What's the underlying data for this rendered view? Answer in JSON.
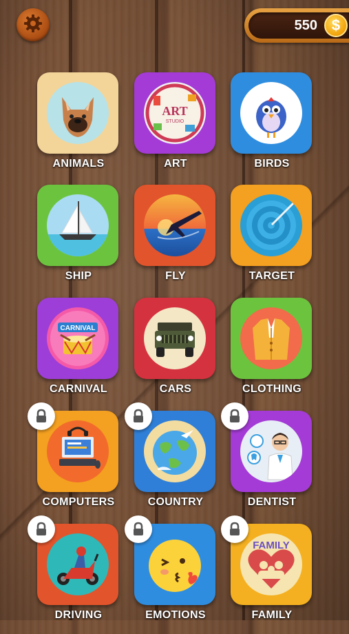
{
  "header": {
    "settings_icon": "gear-icon",
    "coins": "550",
    "coin_symbol": "$"
  },
  "categories": [
    {
      "label": "ANIMALS",
      "locked": false,
      "icon": "dog-icon",
      "color": "#f3d59a"
    },
    {
      "label": "ART",
      "locked": false,
      "icon": "art-studio-icon",
      "color": "#a43bd6"
    },
    {
      "label": "BIRDS",
      "locked": false,
      "icon": "bird-icon",
      "color": "#2f8de0"
    },
    {
      "label": "SHIP",
      "locked": false,
      "icon": "sailboat-icon",
      "color": "#6cc43e"
    },
    {
      "label": "FLY",
      "locked": false,
      "icon": "airplane-icon",
      "color": "#e2542c"
    },
    {
      "label": "TARGET",
      "locked": false,
      "icon": "target-icon",
      "color": "#f4a020"
    },
    {
      "label": "CARNIVAL",
      "locked": false,
      "icon": "carnival-drum-icon",
      "color": "#9d3ed8"
    },
    {
      "label": "CARS",
      "locked": false,
      "icon": "jeep-icon",
      "color": "#d5323f"
    },
    {
      "label": "CLOTHING",
      "locked": false,
      "icon": "jacket-icon",
      "color": "#6cc43e"
    },
    {
      "label": "COMPUTERS",
      "locked": true,
      "icon": "computer-icon",
      "color": "#f4a020"
    },
    {
      "label": "COUNTRY",
      "locked": true,
      "icon": "globe-icon",
      "color": "#2f7fd8"
    },
    {
      "label": "DENTIST",
      "locked": true,
      "icon": "dentist-icon",
      "color": "#a43bd6"
    },
    {
      "label": "DRIVING",
      "locked": true,
      "icon": "scooter-icon",
      "color": "#e2542c"
    },
    {
      "label": "EMOTIONS",
      "locked": true,
      "icon": "kiss-emoji-icon",
      "color": "#2f8de0"
    },
    {
      "label": "FAMILY",
      "locked": true,
      "icon": "family-heart-icon",
      "color": "#f4b020"
    }
  ]
}
